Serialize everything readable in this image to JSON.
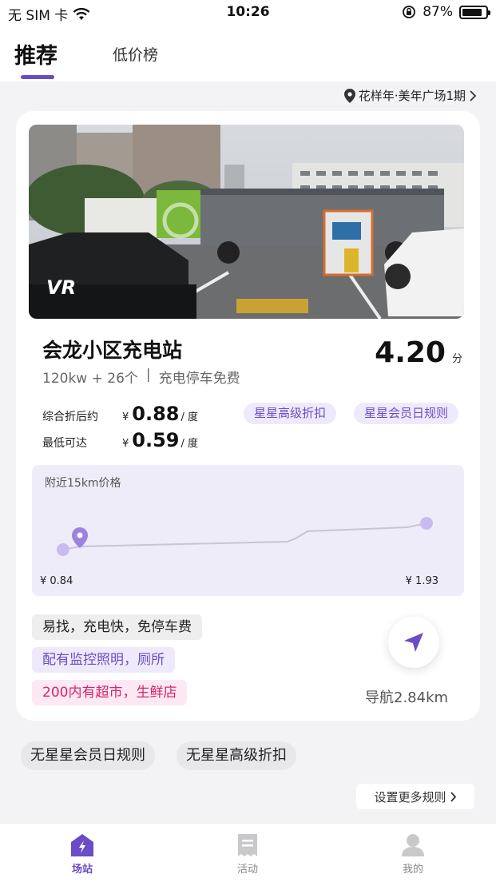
{
  "status_bar": {
    "carrier": "无 SIM 卡",
    "time": "10:26",
    "battery": "87%",
    "battery_level": 0.87
  },
  "tabs": {
    "recommend": "推荐",
    "low_price": "低价榜"
  },
  "location": "花样年·美年广场1期",
  "station": {
    "vr_badge": "VR",
    "name": "会龙小区充电站",
    "power": "120kw + 26个",
    "separator": "|",
    "parking": "充电停车免费",
    "score": "4.20",
    "score_unit": "分",
    "price1_label": "综合折后约",
    "price1_currency": "¥",
    "price1_value": "0.88",
    "price1_unit": "/ 度",
    "price2_label": "最低可达",
    "price2_currency": "¥",
    "price2_value": "0.59",
    "price2_unit": "/ 度",
    "promo1": "星星高级折扣",
    "promo2": "星星会员日规则"
  },
  "price_chart": {
    "title": "附近15km价格",
    "min_label": "¥ 0.84",
    "max_label": "¥ 1.93"
  },
  "features": {
    "tag1": "易找，充电快，免停车费",
    "tag2": "配有监控照明，厕所",
    "tag3": "200内有超市，生鲜店"
  },
  "navigation": {
    "distance": "导航2.84km"
  },
  "rules": {
    "tag1": "无星星会员日规则",
    "tag2": "无星星高级折扣",
    "more": "设置更多规则"
  },
  "bottom_nav": {
    "stations": "场站",
    "activities": "活动",
    "mine": "我的"
  },
  "colors": {
    "accent": "#6a4cc6",
    "pink": "#d6256e",
    "background": "#f3f2f5"
  }
}
